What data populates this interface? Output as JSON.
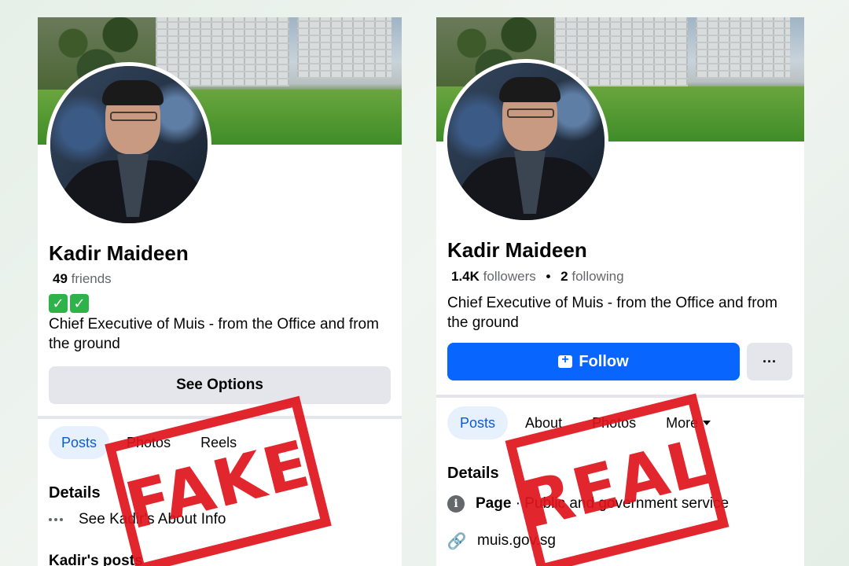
{
  "fake_profile": {
    "name": "Kadir Maideen",
    "friends_count": "49",
    "friends_label": "friends",
    "badges": [
      "✓",
      "✓"
    ],
    "bio": "Chief Executive of Muis - from the Office and from the ground",
    "options_button": "See Options",
    "tabs": [
      "Posts",
      "Photos",
      "Reels"
    ],
    "details_title": "Details",
    "about_link": "See Kadir's About Info",
    "posts_title": "Kadir's posts",
    "stamp": "FAKE"
  },
  "real_profile": {
    "name": "Kadir Maideen",
    "followers_count": "1.4K",
    "followers_label": "followers",
    "separator": "•",
    "following_count": "2",
    "following_label": "following",
    "bio": "Chief Executive of Muis - from the Office and from the ground",
    "follow_button": "Follow",
    "more_button": "···",
    "tabs": [
      "Posts",
      "About",
      "Photos",
      "More"
    ],
    "details_title": "Details",
    "page_label": "Page",
    "page_category": " · Public and government service",
    "website": "muis.gov.sg",
    "stamp": "REAL"
  },
  "colors": {
    "follow_blue": "#0866ff",
    "stamp_red": "#e0141c",
    "active_tab_bg": "#e7f0fd"
  }
}
